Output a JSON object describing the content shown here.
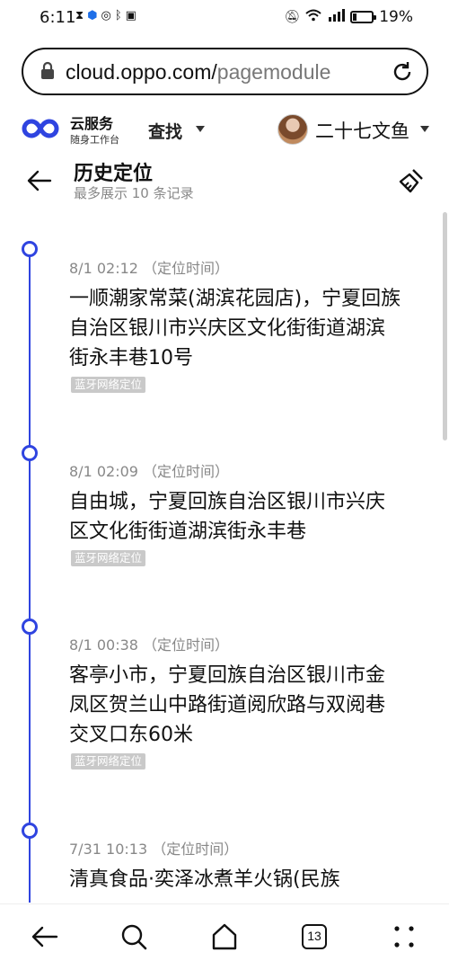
{
  "status_bar": {
    "time": "6:11",
    "left_icons": [
      "hourglass-icon",
      "shield-icon",
      "messenger-icon",
      "bluetooth-icon",
      "sim-icon"
    ],
    "right_icons": [
      "mute-icon",
      "wifi-icon",
      "signal-icon",
      "battery-icon"
    ],
    "battery": "19%",
    "battery_level": 0.19
  },
  "browser": {
    "url_host": "cloud.oppo.com/",
    "url_path": "pagemodule"
  },
  "app_header": {
    "brand_main": "云服务",
    "brand_sub": "随身工作台",
    "brand_color": "#2f44e0",
    "find_label": "查找",
    "username": "二十七文鱼"
  },
  "page": {
    "title": "历史定位",
    "subtitle": "最多展示 10 条记录"
  },
  "accent_color": "#2f44e0",
  "entries": [
    {
      "time": "8/1 02:12 （定位时间）",
      "address": "一顺潮家常菜(湖滨花园店)，宁夏回族自治区银川市兴庆区文化街街道湖滨街永丰巷10号",
      "tag": "蓝牙网络定位"
    },
    {
      "time": "8/1 02:09 （定位时间）",
      "address": "自由城，宁夏回族自治区银川市兴庆区文化街街道湖滨街永丰巷",
      "tag": "蓝牙网络定位"
    },
    {
      "time": "8/1 00:38 （定位时间）",
      "address": "客亭小市，宁夏回族自治区银川市金凤区贺兰山中路街道阅欣路与双阅巷交叉口东60米",
      "tag": "蓝牙网络定位"
    },
    {
      "time": "7/31 10:13 （定位时间）",
      "address": "清真食品·奕泽冰煮羊火锅(民族",
      "tag": ""
    }
  ],
  "nav_bar": {
    "tab_count": "13",
    "icons": [
      "back-icon",
      "search-icon",
      "home-icon",
      "tabs-icon",
      "more-icon"
    ]
  }
}
